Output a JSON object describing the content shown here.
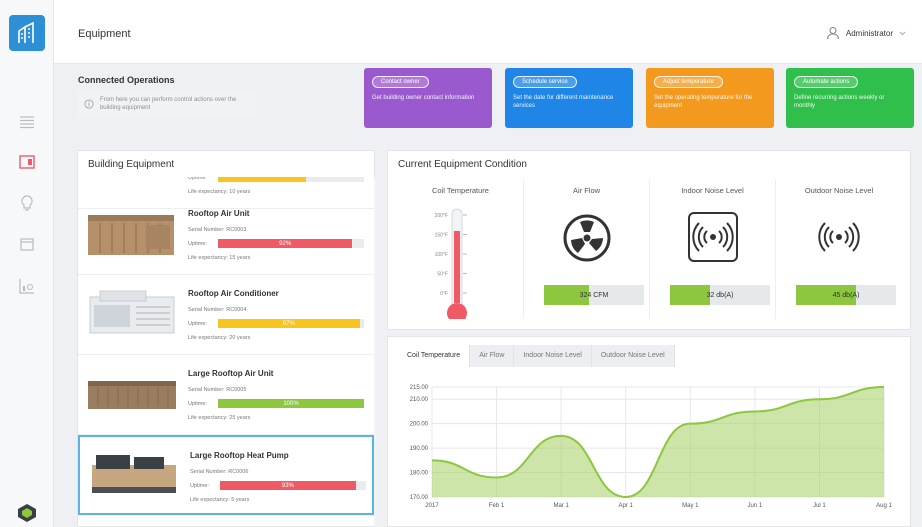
{
  "app": {
    "title": "Equipment",
    "user": "Administrator"
  },
  "sidebar": {
    "icons": [
      "logo-icon",
      "dashboard-icon",
      "equipment-icon",
      "lightbulb-icon",
      "calendar-icon",
      "reports-icon"
    ]
  },
  "operations": {
    "title": "Connected Operations",
    "hint": "From here you can perform control actions over the building equipment",
    "actions": [
      {
        "label": "Contact owner",
        "desc": "Get building owner contact information",
        "color": "#9b59d0"
      },
      {
        "label": "Schedule service",
        "desc": "Set the date for different maintenance services",
        "color": "#1f86e8"
      },
      {
        "label": "Adjust temperature",
        "desc": "Set the operating temperature for the equipment",
        "color": "#f39a1e"
      },
      {
        "label": "Automate actions",
        "desc": "Define recurring actions weekly or monthly",
        "color": "#2fbf4a"
      }
    ]
  },
  "equipment": {
    "title": "Building Equipment",
    "serial_label": "Serial Number:",
    "uptime_label": "Uptime:",
    "life_label": "Life expectancy:",
    "items": [
      {
        "name": "",
        "serial": "",
        "uptime": 60,
        "uptime_label": "",
        "uptime_color": "#f7c51e",
        "life": "10 years"
      },
      {
        "name": "Rooftop Air Unit",
        "serial": "RC0003",
        "uptime": 92,
        "uptime_label": "92%",
        "uptime_color": "#f05a64",
        "life": "15 years"
      },
      {
        "name": "Rooftop Air Conditioner",
        "serial": "RC0004",
        "uptime": 97,
        "uptime_label": "97%",
        "uptime_color": "#f7c51e",
        "life": "20 years"
      },
      {
        "name": "Large Rooftop Air Unit",
        "serial": "RC0005",
        "uptime": 100,
        "uptime_label": "100%",
        "uptime_color": "#8dc63f",
        "life": "25 years"
      },
      {
        "name": "Large Rooftop Heat Pump",
        "serial": "RC0006",
        "uptime": 93,
        "uptime_label": "93%",
        "uptime_color": "#f05a64",
        "life": "5 years"
      }
    ]
  },
  "condition": {
    "title": "Current Equipment Condition",
    "metrics": [
      {
        "label": "Coil Temperature",
        "value": "",
        "fill": 0,
        "icon": "thermometer-icon"
      },
      {
        "label": "Air Flow",
        "value": "324 CFM",
        "fill": 0.45,
        "icon": "fan-icon"
      },
      {
        "label": "Indoor Noise Level",
        "value": "32 db(A)",
        "fill": 0.4,
        "icon": "indoor-noise-icon"
      },
      {
        "label": "Outdoor Noise Level",
        "value": "45 db(A)",
        "fill": 0.6,
        "icon": "outdoor-noise-icon"
      }
    ],
    "thermo_ticks": [
      "200°F",
      "150°F",
      "100°F",
      "50°F",
      "0°F"
    ],
    "thermo_level": 0.8
  },
  "chart_tabs": [
    "Coil Temperature",
    "Air Flow",
    "Indoor Noise Level",
    "Outdoor Noise Level"
  ],
  "chart_data": {
    "type": "area",
    "x": [
      "2017",
      "Feb 1",
      "Mar 1",
      "Apr 1",
      "May 1",
      "Jun 1",
      "Jul 1",
      "Aug 1"
    ],
    "series": [
      {
        "values": [
          185,
          178,
          195,
          170,
          200,
          205,
          210,
          215
        ]
      }
    ],
    "yticks": [
      "215.00",
      "210.00",
      "200.00",
      "190.00",
      "180.00",
      "170.00"
    ],
    "ylim": [
      170,
      215
    ],
    "grid": true,
    "color": "#a6cf62"
  }
}
